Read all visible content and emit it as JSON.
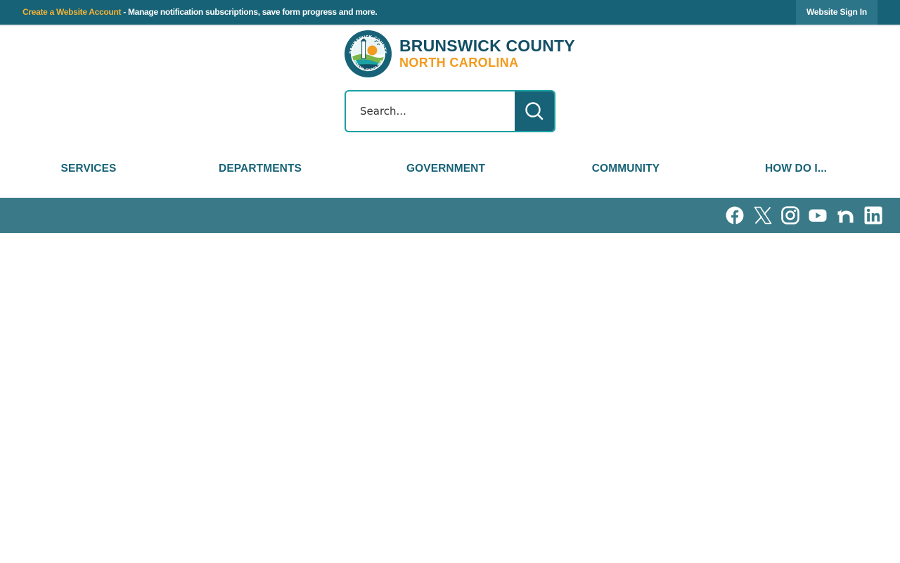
{
  "topbar": {
    "create_account_label": "Create a Website Account",
    "message": " - Manage notification subscriptions, save form progress and more.",
    "sign_in_label": "Website Sign In"
  },
  "logo": {
    "line1": "BRUNSWICK COUNTY",
    "line2": "NORTH CAROLINA",
    "seal_icon": "brunswick-county-seal"
  },
  "search": {
    "placeholder": "Search...",
    "value": "",
    "button_icon": "search-icon"
  },
  "nav": {
    "items": [
      {
        "label": "SERVICES"
      },
      {
        "label": "DEPARTMENTS"
      },
      {
        "label": "GOVERNMENT"
      },
      {
        "label": "COMMUNITY"
      },
      {
        "label": "HOW DO I..."
      }
    ]
  },
  "social": {
    "icons": [
      "facebook-icon",
      "x-icon",
      "instagram-icon",
      "youtube-icon",
      "nextdoor-icon",
      "linkedin-icon"
    ]
  },
  "colors": {
    "topbar": "#176277",
    "accent_gold": "#f5b335",
    "brand_teal": "#134f66",
    "brand_orange": "#f29b1e",
    "search_border": "#1ba0a3",
    "social_bar": "#3a7a88"
  }
}
